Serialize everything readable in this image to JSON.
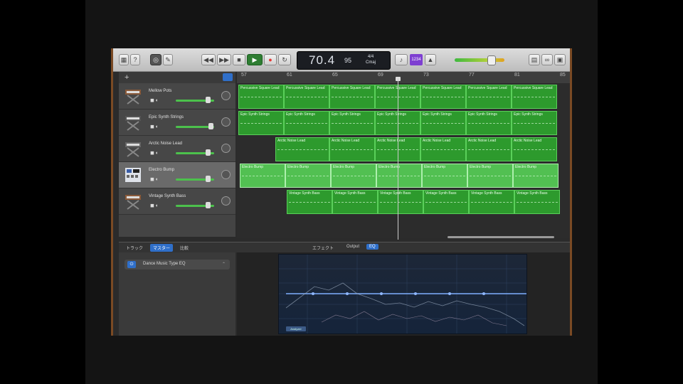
{
  "transport": {
    "position": "70.4",
    "tempo": "95",
    "signature_top": "4/4",
    "key": "Cmaj",
    "cycle_label": "1234"
  },
  "ruler": {
    "ticks": [
      "57",
      "61",
      "65",
      "69",
      "73",
      "77",
      "81",
      "85"
    ]
  },
  "tracks": [
    {
      "name": "Mellow Pots",
      "region_label": "Percussive Square Lead",
      "selected": false
    },
    {
      "name": "Epic Synth Strings",
      "region_label": "Epic Synth Strings",
      "selected": false
    },
    {
      "name": "Arctic Noise Lead",
      "region_label": "Arctic Noise Lead",
      "selected": false
    },
    {
      "name": "Electro Bump",
      "region_label": "Electro Bump",
      "selected": true
    },
    {
      "name": "Vintage Synth Bass",
      "region_label": "Vintage Synth Bass",
      "selected": false
    }
  ],
  "bottom_tabs": {
    "track": "トラック",
    "master": "マスター",
    "compare": "比較",
    "effects": "エフェクト",
    "output": "Output",
    "eq": "EQ"
  },
  "plugin": {
    "name": "Dance Music Type EQ"
  },
  "eq": {
    "analyzer_label": "Analyzer"
  },
  "colors": {
    "region": "#2d9a2d",
    "region_selected": "#52c052",
    "accent": "#2f6fc9",
    "play": "#2e7d32"
  }
}
